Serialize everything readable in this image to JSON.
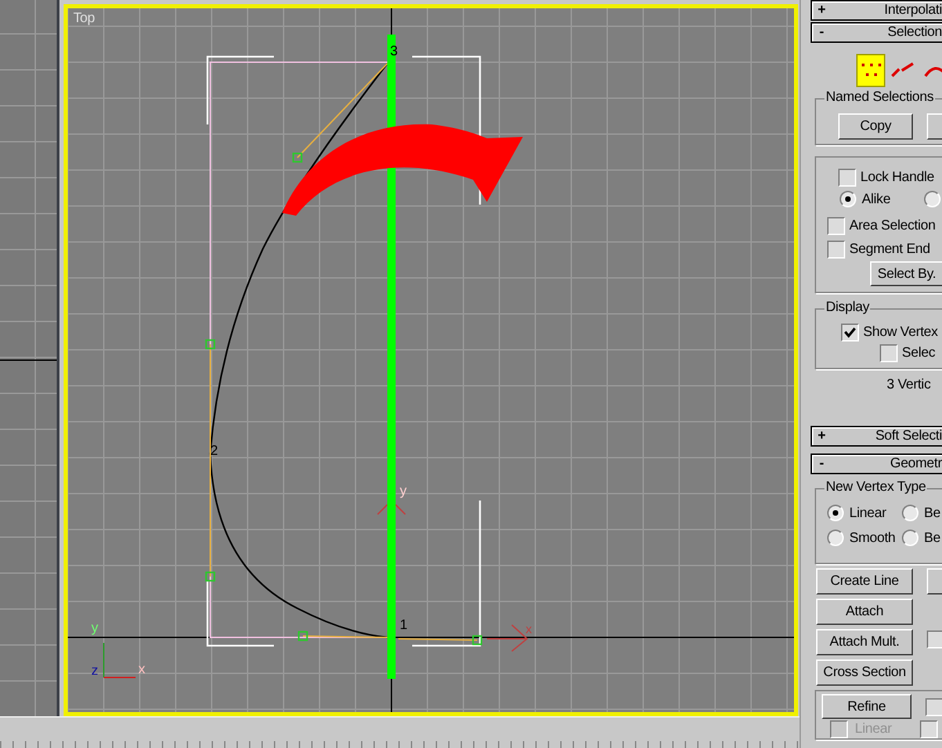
{
  "viewport": {
    "label": "Top",
    "vertex_labels": [
      "1",
      "2",
      "3"
    ],
    "gizmo_labels": [
      "x",
      "y"
    ],
    "tripod_labels": [
      "y",
      "z",
      "x"
    ]
  },
  "panel": {
    "interpolation_rollout": {
      "sign": "+",
      "title": "Interpolati"
    },
    "selection_rollout": {
      "sign": "-",
      "title": "Selection",
      "levels": [
        {
          "kind": "vertex",
          "selected": true
        },
        {
          "kind": "segment",
          "selected": false
        },
        {
          "kind": "spline",
          "selected": false
        }
      ],
      "named_selections": {
        "title": "Named Selections",
        "copy": "Copy"
      },
      "lock_handles": {
        "label": "Lock Handle",
        "checked": false
      },
      "handle_mode": [
        {
          "label": "Alike",
          "selected": true
        },
        {
          "selected": false
        }
      ],
      "area_selection": {
        "label": "Area Selection",
        "checked": false
      },
      "segment_end": {
        "label": "Segment End",
        "checked": false
      },
      "select_by": "Select By.",
      "display": {
        "title": "Display",
        "show_vertex": {
          "label": "Show Vertex",
          "checked": true
        },
        "selected_only": {
          "label": "Selec",
          "checked": false
        }
      },
      "status": "3 Vertic"
    },
    "soft_selection_rollout": {
      "sign": "+",
      "title": "Soft Selecti"
    },
    "geometry_rollout": {
      "sign": "-",
      "title": "Geometr",
      "new_vertex_type": {
        "title": "New Vertex Type",
        "options": [
          {
            "label": "Linear",
            "selected": true
          },
          {
            "label": "Be",
            "selected": false
          },
          {
            "label": "Smooth",
            "selected": false
          },
          {
            "label": "Be",
            "selected": false
          }
        ]
      },
      "buttons": [
        "Create Line",
        "Attach",
        "Attach Mult.",
        "Cross Section"
      ],
      "attach_option": {
        "checked": false
      },
      "refine": "Refine",
      "refine_option": {
        "checked": false
      },
      "linear": {
        "label": "Linear",
        "checked": false
      },
      "linear_side_option": {
        "checked": false
      }
    }
  }
}
